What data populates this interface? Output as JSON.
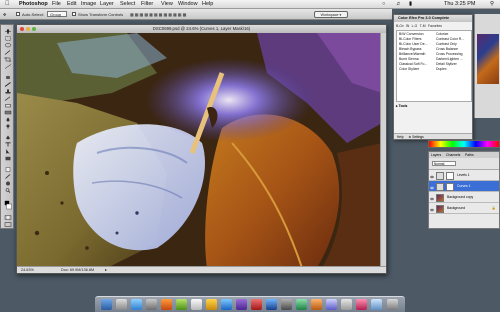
{
  "menubar": {
    "app_name": "Photoshop",
    "menus": [
      "File",
      "Edit",
      "Image",
      "Layer",
      "Select",
      "Filter",
      "View",
      "Window",
      "Help"
    ],
    "clock": "Thu 3:25 PM"
  },
  "optbar": {
    "auto_select": "Auto-Select:",
    "group": "Group",
    "transform": "Show Transform Controls",
    "workspace": "Workspace ▾"
  },
  "document": {
    "title": "DSC0699.psd @ 24.6% (Curves 1, Layer Mask/16)",
    "zoom": "24.63%",
    "doc_size": "Doc: 69.9M/136.8M"
  },
  "efex": {
    "title": "Color Efex Pro 3.0 Complete",
    "tabs": [
      "B-Ov",
      "Bi",
      "L-G",
      "T-M",
      "Favorites"
    ],
    "filters_left": [
      "B/W Conversion",
      "Bi-Color Filters",
      "Bi-Color User De...",
      "Bleach Bypass",
      "Brilliance/Warmth",
      "Burnt Sienna",
      "Classical Soft Fo...",
      "Color Stylizer"
    ],
    "filters_right": [
      "Colorize",
      "Contrast Color R...",
      "Contrast Only",
      "Cross Balance",
      "Cross Processing",
      "Darken/Lighten ...",
      "Detail Stylizer",
      "Duplex"
    ],
    "tools_label": "Tools",
    "help": "Help",
    "settings": "Settings"
  },
  "layers": {
    "tabs": [
      "Layers",
      "Channels",
      "Paths"
    ],
    "blend_mode": "Normal",
    "rows": [
      "Levels 1",
      "Curves 1",
      "Background copy",
      "Background"
    ]
  }
}
